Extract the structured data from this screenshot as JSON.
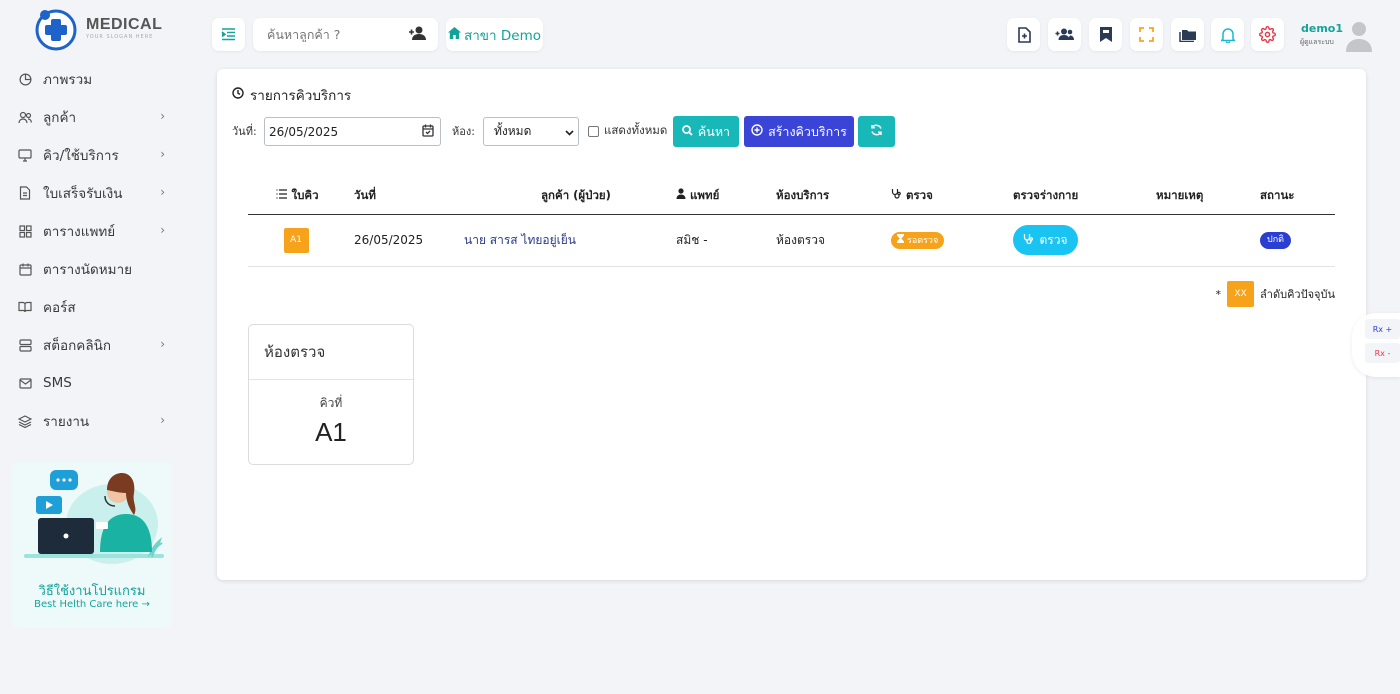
{
  "logo": {
    "title": "MEDICAL",
    "slogan": "YOUR SLOGAN HERE"
  },
  "sidebar": {
    "items": [
      {
        "label": "ภาพรวม",
        "icon": "pie-chart-icon",
        "has_children": false
      },
      {
        "label": "ลูกค้า",
        "icon": "users-icon",
        "has_children": true
      },
      {
        "label": "คิว/ใช้บริการ",
        "icon": "monitor-icon",
        "has_children": true
      },
      {
        "label": "ใบเสร็จรับเงิน",
        "icon": "document-icon",
        "has_children": true
      },
      {
        "label": "ตารางแพทย์",
        "icon": "grid-icon",
        "has_children": true
      },
      {
        "label": "ตารางนัดหมาย",
        "icon": "calendar-icon",
        "has_children": false
      },
      {
        "label": "คอร์ส",
        "icon": "book-icon",
        "has_children": false
      },
      {
        "label": "สต็อกคลินิก",
        "icon": "server-icon",
        "has_children": true
      },
      {
        "label": "SMS",
        "icon": "mail-icon",
        "has_children": false
      },
      {
        "label": "รายงาน",
        "icon": "layers-icon",
        "has_children": true
      }
    ],
    "help": {
      "title": "วิธีใช้งานโปรแกรม",
      "subtitle": "Best Helth Care here"
    }
  },
  "topbar": {
    "search_placeholder": "ค้นหาลูกค้า ?",
    "branch_label": "สาขา Demo",
    "user": {
      "name": "demo1",
      "role": "ผู้ดูแลระบบ"
    }
  },
  "page": {
    "title": "รายการคิวบริการ",
    "filters": {
      "date_label": "วันที่:",
      "date_value": "26/05/2025",
      "room_label": "ห้อง:",
      "room_selected": "ทั้งหมด",
      "show_all_label": "แสดงทั้งหมด",
      "show_all_checked": false
    },
    "buttons": {
      "search": "ค้นหา",
      "create": "สร้างคิวบริการ"
    },
    "table": {
      "headers": [
        "ใบคิว",
        "วันที่",
        "ลูกค้า (ผู้ป่วย)",
        "แพทย์",
        "ห้องบริการ",
        "ตรวจ",
        "ตรวจร่างกาย",
        "หมายเหตุ",
        "สถานะ"
      ],
      "rows": [
        {
          "queue": "A1",
          "date": "26/05/2025",
          "customer": "นาย สารส ไทยอยู่เย็น",
          "doctor": "สมิช -",
          "room": "ห้องตรวจ",
          "exam_status": "รอตรวจ",
          "physical_exam": "ตรวจ",
          "note": "",
          "status": "ปกติ"
        }
      ]
    },
    "legend": {
      "badge": "XX",
      "prefix": "*",
      "label": "ลำดับคิวปัจจุบัน"
    },
    "room_card": {
      "title": "ห้องตรวจ",
      "label": "คิวที่",
      "queue": "A1"
    }
  },
  "float": {
    "increase": "Rx +",
    "decrease": "Rx -"
  },
  "colors": {
    "accent": "#14a39a",
    "primary": "#3a45d8",
    "teal_button": "#19b8b8",
    "warning": "#f7a21b",
    "info": "#19c4f2",
    "status": "#2a3fd1"
  }
}
